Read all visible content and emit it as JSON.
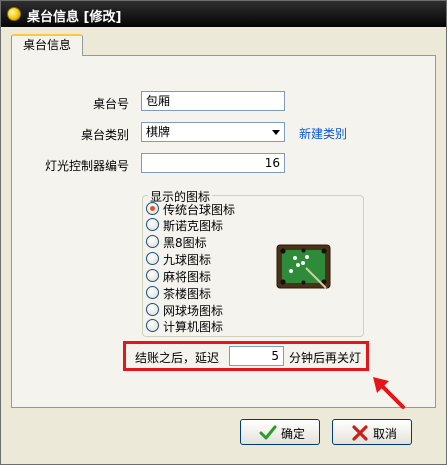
{
  "window": {
    "title": "桌台信息 [修改]"
  },
  "tabs": [
    {
      "label": "桌台信息"
    }
  ],
  "form": {
    "table_no_label": "桌台号",
    "table_no_value": "包厢",
    "category_label": "桌台类别",
    "category_value": "棋牌",
    "new_category_link": "新建类别",
    "light_controller_label": "灯光控制器编号",
    "light_controller_value": "16"
  },
  "icon_group": {
    "title": "显示的图标",
    "options": [
      {
        "label": "传统台球图标",
        "checked": true
      },
      {
        "label": "斯诺克图标",
        "checked": false
      },
      {
        "label": "黑8图标",
        "checked": false
      },
      {
        "label": "九球图标",
        "checked": false
      },
      {
        "label": "麻将图标",
        "checked": false
      },
      {
        "label": "茶楼图标",
        "checked": false
      },
      {
        "label": "网球场图标",
        "checked": false
      },
      {
        "label": "计算机图标",
        "checked": false
      }
    ],
    "preview_icon": "billiard-table-icon"
  },
  "light_off": {
    "prefix": "结账之后，延迟",
    "value": "5",
    "suffix": "分钟后再关灯"
  },
  "buttons": {
    "ok_label": "确定",
    "cancel_label": "取消"
  },
  "colors": {
    "highlight_border": "#e3161b",
    "link": "#0b57d0",
    "table_felt": "#2e8b3a"
  }
}
